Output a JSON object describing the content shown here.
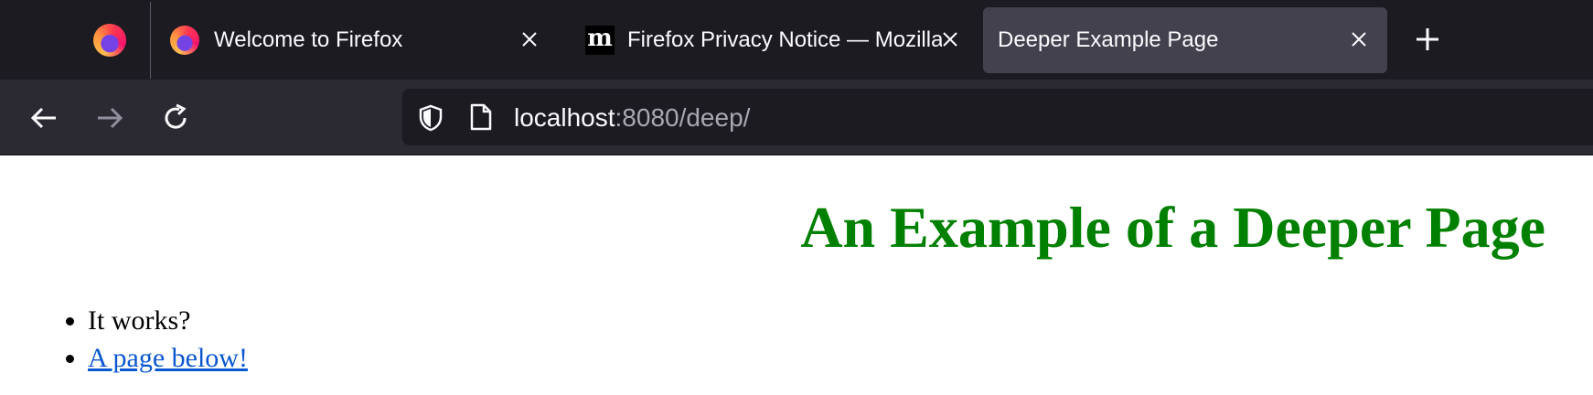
{
  "browser": {
    "tabs": [
      {
        "title": "Welcome to Firefox",
        "favicon": "firefox-logo-icon",
        "active": false
      },
      {
        "title": "Firefox Privacy Notice — Mozilla",
        "favicon": "mozilla-m-icon",
        "active": false
      },
      {
        "title": "Deeper Example Page",
        "favicon": "",
        "active": true
      }
    ],
    "pinned_tab_favicon": "firefox-logo-icon",
    "url_host": "localhost",
    "url_rest": ":8080/deep/",
    "mozilla_favicon_letter": "m",
    "colors": {
      "chrome_bg": "#1c1b22",
      "active_tab": "#42414d",
      "toolbar": "#2b2a33"
    }
  },
  "page": {
    "heading": "An Example of a Deeper Page",
    "heading_color": "#008000",
    "list_items": [
      {
        "text": "It works?",
        "is_link": false
      },
      {
        "text": "A page below!",
        "is_link": true
      }
    ]
  }
}
